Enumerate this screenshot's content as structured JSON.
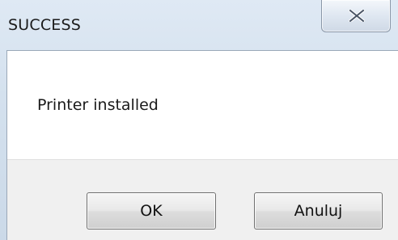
{
  "window": {
    "title": "SUCCESS",
    "close_icon": "close-icon"
  },
  "content": {
    "message": "Printer installed"
  },
  "buttons": {
    "ok_label": "OK",
    "cancel_label": "Anuluj"
  }
}
